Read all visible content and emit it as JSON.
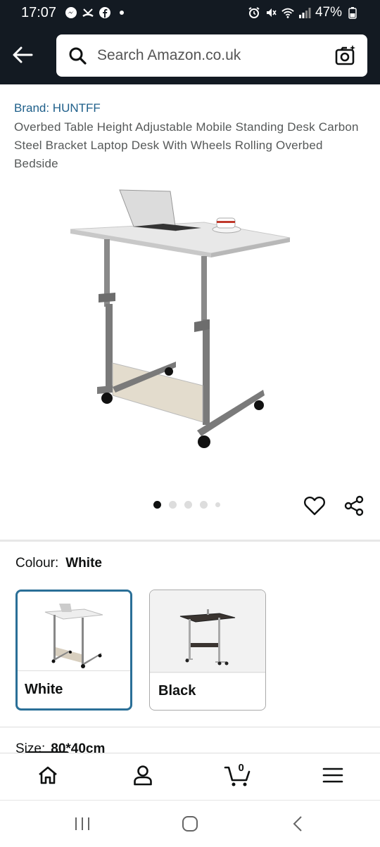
{
  "status_bar": {
    "time": "17:07",
    "battery": "47%",
    "left_icons": [
      "messenger-icon",
      "missed-call-icon",
      "facebook-icon",
      "dot-icon"
    ],
    "right_icons": [
      "alarm-icon",
      "mute-icon",
      "wifi-icon",
      "signal-icon",
      "battery-icon"
    ]
  },
  "header": {
    "search_placeholder": "Search Amazon.co.uk",
    "background_color": "#131a22"
  },
  "product": {
    "brand": "Brand: HUNTFF",
    "title": "Overbed Table Height Adjustable Mobile Standing Desk Carbon Steel Bracket Laptop Desk With Wheels Rolling Overbed Bedside",
    "image_count": 5,
    "active_image_index": 0
  },
  "colour": {
    "label": "Colour:",
    "selected": "White",
    "options": [
      {
        "label": "White",
        "selected": true
      },
      {
        "label": "Black",
        "selected": false
      }
    ]
  },
  "size": {
    "label": "Size:",
    "value": "80*40cm"
  },
  "bottom_nav": {
    "items": [
      "home-icon",
      "account-icon",
      "cart-icon",
      "menu-icon"
    ],
    "cart_count": "0"
  },
  "system_nav": [
    "recent-apps-icon",
    "home-button-icon",
    "back-button-icon"
  ],
  "colors": {
    "brand_link": "#1e5f8a",
    "selected_border": "#2a6f97",
    "text_secondary": "#565959"
  }
}
